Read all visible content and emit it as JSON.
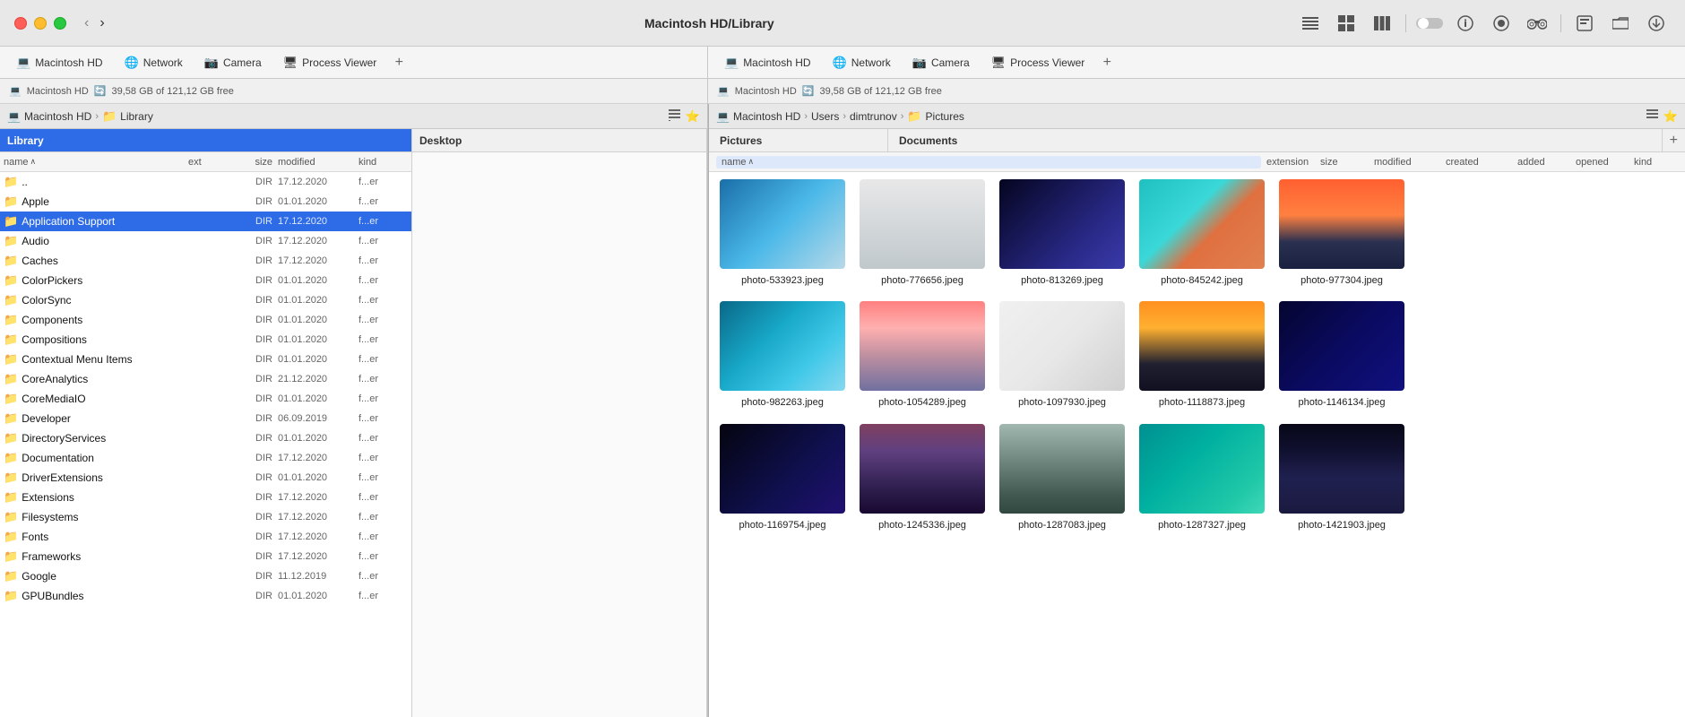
{
  "window": {
    "title": "Macintosh HD/Library"
  },
  "traffic_lights": {
    "red_label": "close",
    "yellow_label": "minimize",
    "green_label": "maximize"
  },
  "toolbar": {
    "list_view_icon": "≡",
    "icon_view_icon": "⊞",
    "column_view_icon": "⣿",
    "toggle_icon": "⬤",
    "info_icon": "ℹ",
    "preview_icon": "◉",
    "binoculars_icon": "⌕",
    "tag_icon": "⬛",
    "folder_icon": "⬛",
    "download_icon": "⬇"
  },
  "left_tabs": [
    {
      "label": "Macintosh HD",
      "icon": "💻"
    },
    {
      "label": "Network",
      "icon": "🌐"
    },
    {
      "label": "Camera",
      "icon": "📷"
    },
    {
      "label": "Process Viewer",
      "icon": "🖥"
    }
  ],
  "right_tabs": [
    {
      "label": "Macintosh HD",
      "icon": "💻"
    },
    {
      "label": "Network",
      "icon": "🌐"
    },
    {
      "label": "Camera",
      "icon": "📷"
    },
    {
      "label": "Process Viewer",
      "icon": "🖥"
    }
  ],
  "left_status": {
    "drive_icon": "💻",
    "drive_label": "Macintosh HD",
    "sync_icon": "🔄",
    "storage": "39,58 GB of 121,12 GB free"
  },
  "right_status": {
    "drive_icon": "💻",
    "drive_label": "Macintosh HD",
    "sync_icon": "🔄",
    "storage": "39,58 GB of 121,12 GB free"
  },
  "left_panel": {
    "breadcrumb": [
      {
        "label": "Macintosh HD",
        "icon": "💻"
      },
      {
        "label": "Library"
      }
    ],
    "columns": [
      {
        "id": "library",
        "label": "Library",
        "active": true
      },
      {
        "id": "desktop",
        "label": "Desktop",
        "active": false
      }
    ],
    "table_headers": {
      "name": "name",
      "sort_arrow": "∧",
      "ext": "ext",
      "size": "size",
      "modified": "modified",
      "kind": "kind"
    },
    "files": [
      {
        "name": "..",
        "icon": "📁",
        "ext": "",
        "size": "DIR",
        "modified": "17.12.2020",
        "kind": "f...er"
      },
      {
        "name": "Apple",
        "icon": "📁",
        "ext": "",
        "size": "DIR",
        "modified": "01.01.2020",
        "kind": "f...er"
      },
      {
        "name": "Application Support",
        "icon": "📁",
        "ext": "",
        "size": "DIR",
        "modified": "17.12.2020",
        "kind": "f...er",
        "selected": true
      },
      {
        "name": "Audio",
        "icon": "📁",
        "ext": "",
        "size": "DIR",
        "modified": "17.12.2020",
        "kind": "f...er"
      },
      {
        "name": "Caches",
        "icon": "📁",
        "ext": "",
        "size": "DIR",
        "modified": "17.12.2020",
        "kind": "f...er"
      },
      {
        "name": "ColorPickers",
        "icon": "📁",
        "ext": "",
        "size": "DIR",
        "modified": "01.01.2020",
        "kind": "f...er"
      },
      {
        "name": "ColorSync",
        "icon": "📁",
        "ext": "",
        "size": "DIR",
        "modified": "01.01.2020",
        "kind": "f...er"
      },
      {
        "name": "Components",
        "icon": "📁",
        "ext": "",
        "size": "DIR",
        "modified": "01.01.2020",
        "kind": "f...er"
      },
      {
        "name": "Compositions",
        "icon": "📁",
        "ext": "",
        "size": "DIR",
        "modified": "01.01.2020",
        "kind": "f...er"
      },
      {
        "name": "Contextual Menu Items",
        "icon": "📁",
        "ext": "",
        "size": "DIR",
        "modified": "01.01.2020",
        "kind": "f...er"
      },
      {
        "name": "CoreAnalytics",
        "icon": "📁",
        "ext": "",
        "size": "DIR",
        "modified": "21.12.2020",
        "kind": "f...er"
      },
      {
        "name": "CoreMediaIO",
        "icon": "📁",
        "ext": "",
        "size": "DIR",
        "modified": "01.01.2020",
        "kind": "f...er"
      },
      {
        "name": "Developer",
        "icon": "📁",
        "ext": "",
        "size": "DIR",
        "modified": "06.09.2019",
        "kind": "f...er"
      },
      {
        "name": "DirectoryServices",
        "icon": "📁",
        "ext": "",
        "size": "DIR",
        "modified": "01.01.2020",
        "kind": "f...er"
      },
      {
        "name": "Documentation",
        "icon": "📁",
        "ext": "",
        "size": "DIR",
        "modified": "17.12.2020",
        "kind": "f...er"
      },
      {
        "name": "DriverExtensions",
        "icon": "📁",
        "ext": "",
        "size": "DIR",
        "modified": "01.01.2020",
        "kind": "f...er"
      },
      {
        "name": "Extensions",
        "icon": "📁",
        "ext": "",
        "size": "DIR",
        "modified": "17.12.2020",
        "kind": "f...er"
      },
      {
        "name": "Filesystems",
        "icon": "📁",
        "ext": "",
        "size": "DIR",
        "modified": "17.12.2020",
        "kind": "f...er"
      },
      {
        "name": "Fonts",
        "icon": "📁",
        "ext": "",
        "size": "DIR",
        "modified": "17.12.2020",
        "kind": "f...er"
      },
      {
        "name": "Frameworks",
        "icon": "📁",
        "ext": "",
        "size": "DIR",
        "modified": "17.12.2020",
        "kind": "f...er"
      },
      {
        "name": "Google",
        "icon": "📁",
        "ext": "",
        "size": "DIR",
        "modified": "11.12.2019",
        "kind": "f...er"
      },
      {
        "name": "GPUBundles",
        "icon": "📁",
        "ext": "",
        "size": "DIR",
        "modified": "01.01.2020",
        "kind": "f...er"
      }
    ]
  },
  "right_panel": {
    "breadcrumb": [
      {
        "label": "Macintosh HD",
        "icon": "💻"
      },
      {
        "label": "Users"
      },
      {
        "label": "dimtrunov"
      },
      {
        "label": "Pictures"
      }
    ],
    "col_headers": [
      {
        "label": "Pictures",
        "active": false
      },
      {
        "label": "Documents",
        "active": false
      }
    ],
    "table_headers": {
      "name": "name",
      "sort_arrow": "∧",
      "extension": "extension",
      "size": "size",
      "modified": "modified",
      "created": "created",
      "added": "added",
      "opened": "opened",
      "kind": "kind"
    },
    "grid_rows": [
      [
        {
          "label": "photo-533923.jpeg",
          "thumb_class": "thumb-ocean"
        },
        {
          "label": "photo-776656.jpeg",
          "thumb_class": "thumb-birds"
        },
        {
          "label": "photo-813269.jpeg",
          "thumb_class": "thumb-galaxy"
        },
        {
          "label": "photo-845242.jpeg",
          "thumb_class": "thumb-doors"
        },
        {
          "label": "photo-977304.jpeg",
          "thumb_class": "thumb-sunset-wires"
        }
      ],
      [
        {
          "label": "photo-982263.jpeg",
          "thumb_class": "thumb-wave"
        },
        {
          "label": "photo-1054289.jpeg",
          "thumb_class": "thumb-mountains"
        },
        {
          "label": "photo-1097930.jpeg",
          "thumb_class": "thumb-paper"
        },
        {
          "label": "photo-1118873.jpeg",
          "thumb_class": "thumb-gold-sunset"
        },
        {
          "label": "photo-1146134.jpeg",
          "thumb_class": "thumb-dark-ocean"
        }
      ],
      [
        {
          "label": "photo-1169754.jpeg",
          "thumb_class": "thumb-stars"
        },
        {
          "label": "photo-1245336.jpeg",
          "thumb_class": "thumb-dusk"
        },
        {
          "label": "photo-1287083.jpeg",
          "thumb_class": "thumb-fog-forest"
        },
        {
          "label": "photo-1287327.jpeg",
          "thumb_class": "thumb-teal-water"
        },
        {
          "label": "photo-1421903.jpeg",
          "thumb_class": "thumb-dark-shore"
        }
      ]
    ]
  }
}
